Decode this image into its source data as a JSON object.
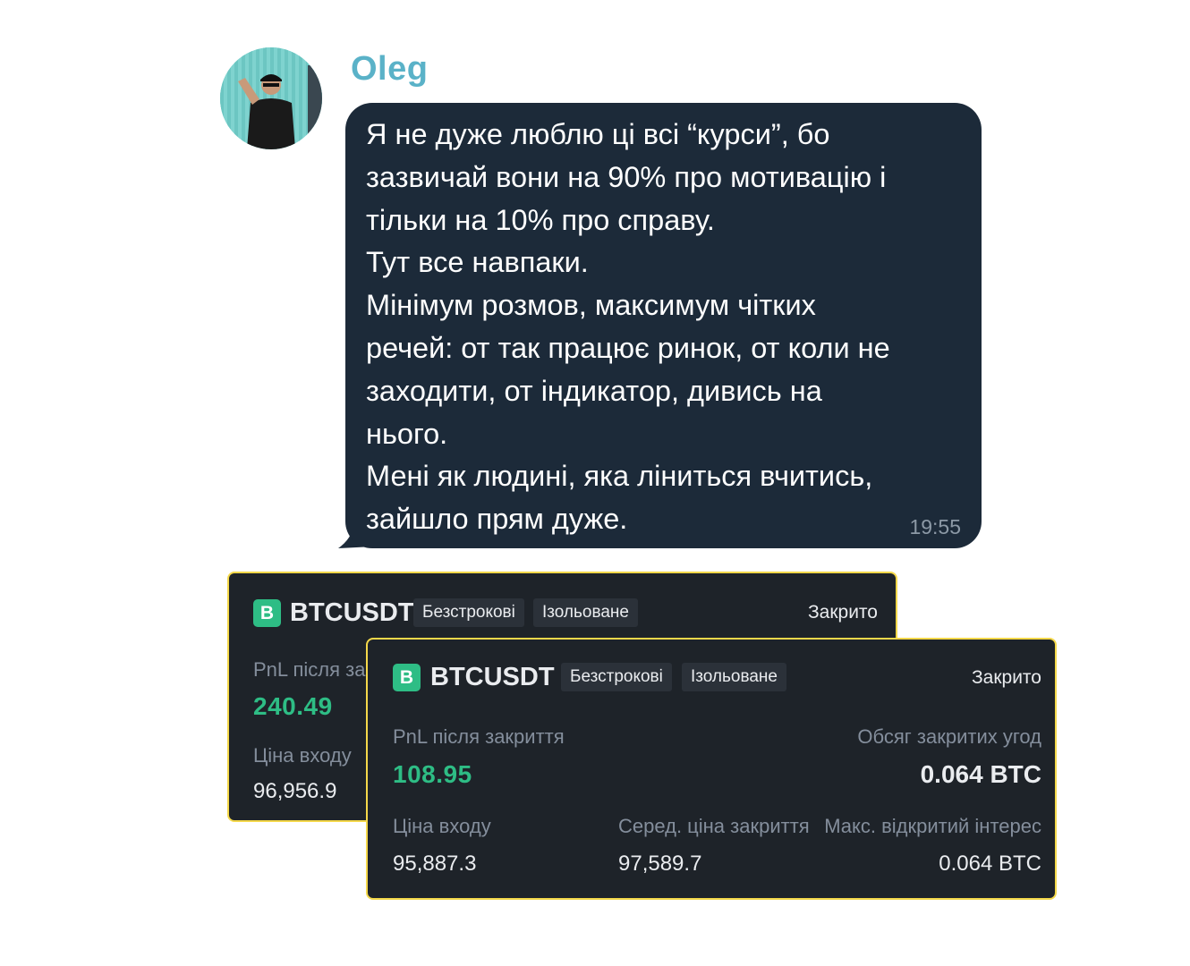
{
  "message": {
    "sender": "Oleg",
    "lines": [
      "Я не дуже люблю ці всі “курси”, бо",
      "зазвичай вони на 90% про мотивацію і",
      "тільки на 10% про справу.",
      "Тут все навпаки.",
      "Мінімум розмов, максимум чітких",
      "речей: от так працює ринок, от коли не",
      "заходити, от індикатор, дивись на",
      "нього.",
      "Мені як людині, яка лінить­ся вчитись,",
      "зайшло прям дуже."
    ],
    "time": "19:55"
  },
  "card_back": {
    "badge": "B",
    "pair": "BTCUSDT",
    "tag1": "Безстрокові",
    "tag2": "Ізольоване",
    "status": "Закрито",
    "pnl_label": "PnL після закриття",
    "pnl_value": "240.49",
    "entry_label": "Ціна входу",
    "entry_value": "96,956.9"
  },
  "card_front": {
    "badge": "B",
    "pair": "BTCUSDT",
    "tag1": "Безстрокові",
    "tag2": "Ізольоване",
    "status": "Закрито",
    "pnl_label": "PnL після закриття",
    "pnl_value": "108.95",
    "volume_label": "Обсяг закритих угод",
    "volume_value": "0.064 BTC",
    "entry_label": "Ціна входу",
    "entry_value": "95,887.3",
    "avg_close_label": "Серед. ціна закриття",
    "avg_close_value": "97,589.7",
    "max_oi_label": "Макс. відкритий інтерес",
    "max_oi_value": "0.064 BTC"
  },
  "colors": {
    "bubble": "#1c2a39",
    "sender": "#5ab2c8",
    "card_bg": "#1e2329",
    "card_border": "#f4d84a",
    "profit_green": "#2ebd85",
    "muted_label": "#848e9c"
  }
}
